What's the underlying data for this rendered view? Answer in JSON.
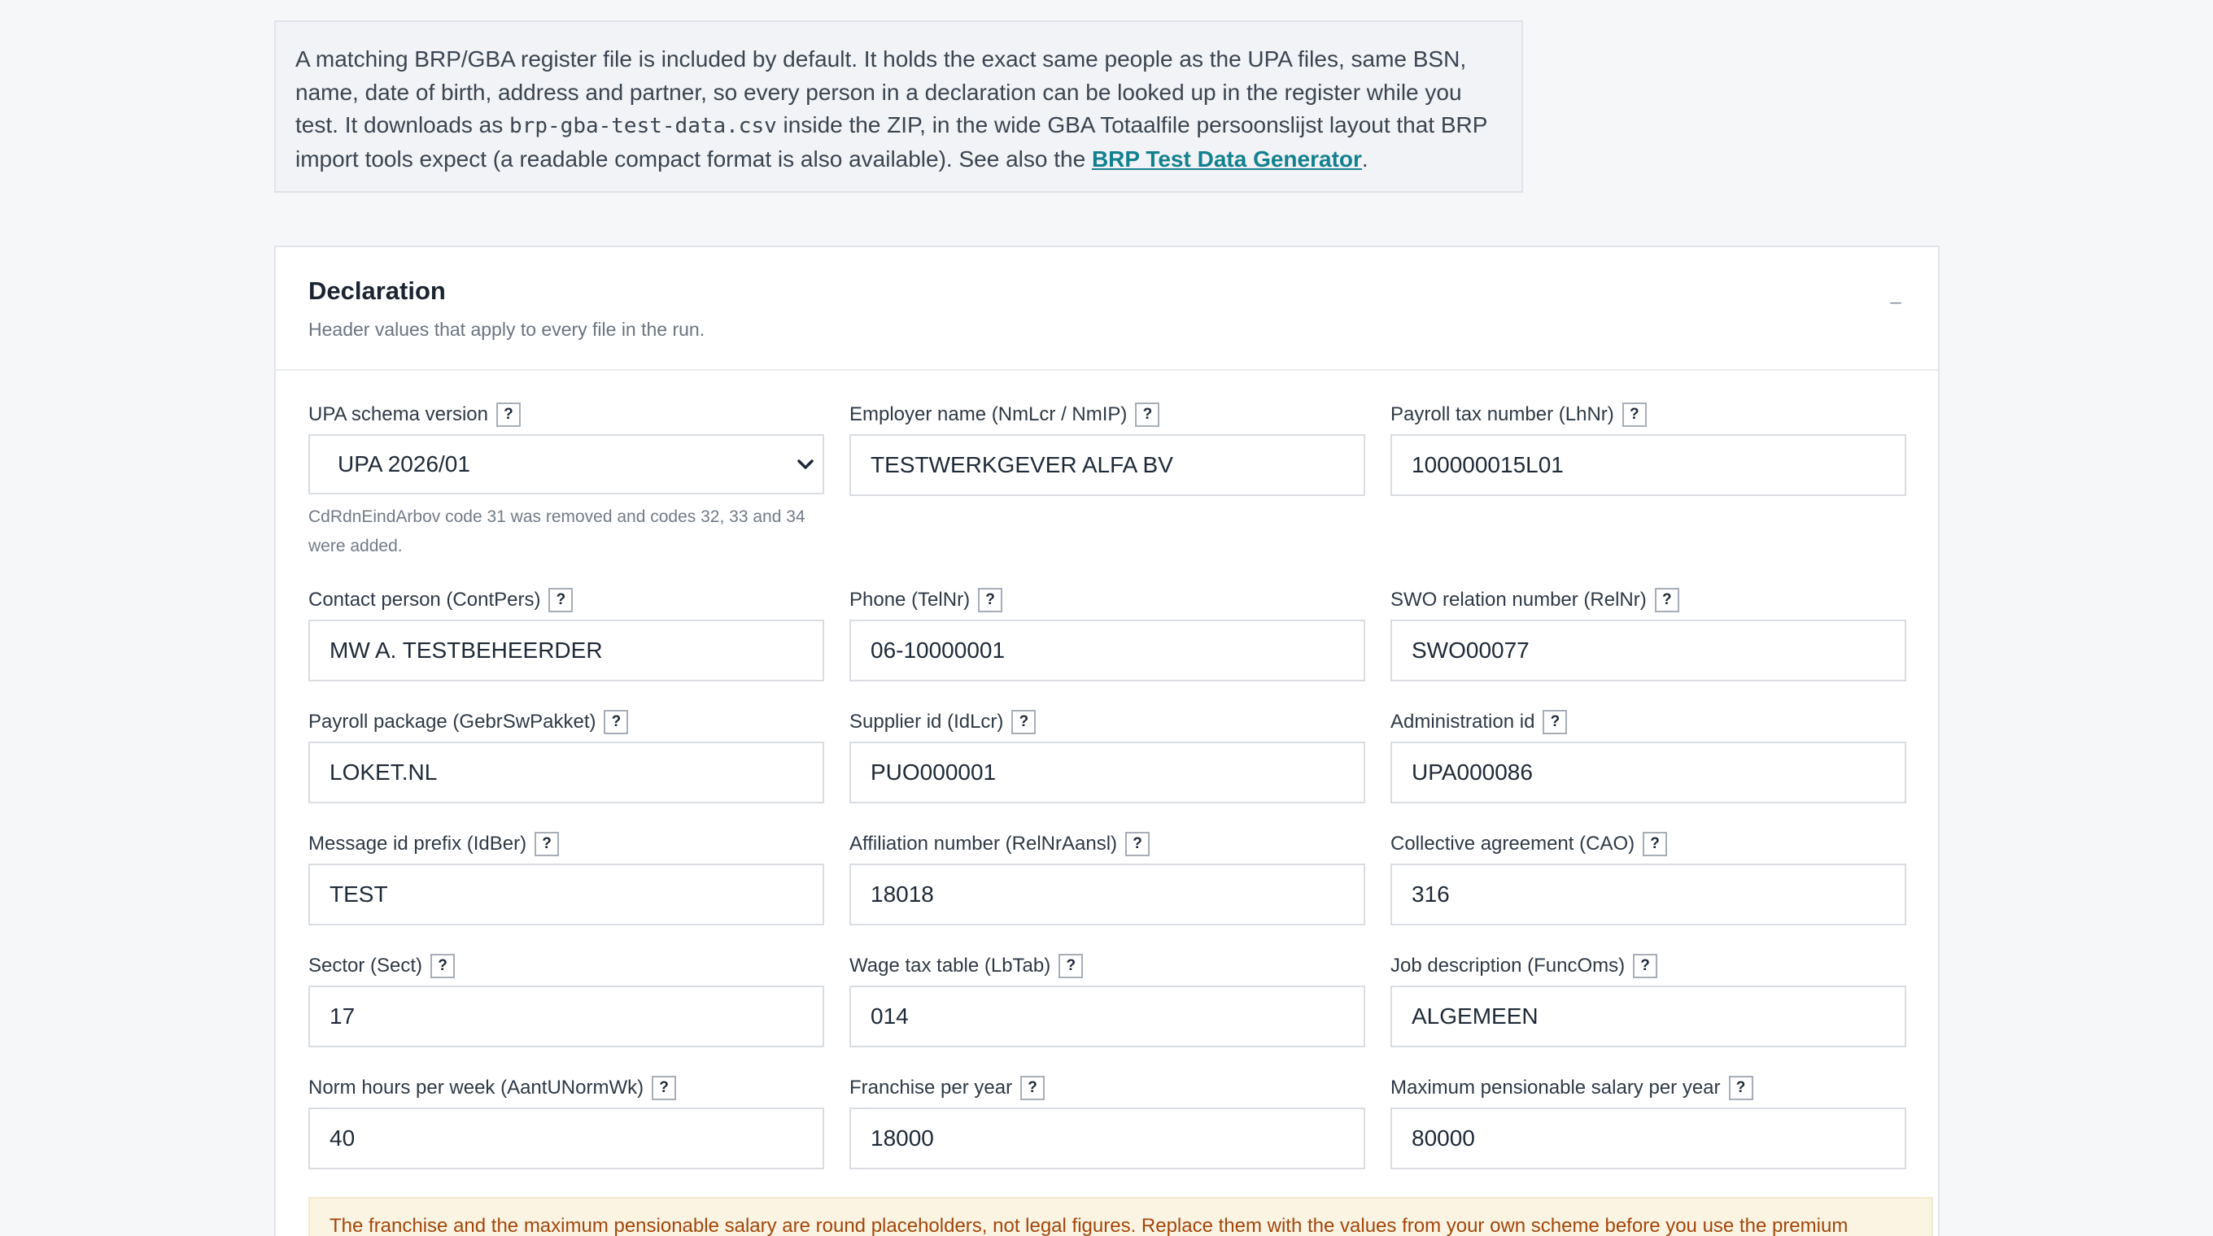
{
  "info": {
    "text_before": "A matching BRP/GBA register file is included by default. It holds the exact same people as the UPA files, same BSN, name, date of birth, address and partner, so every person in a declaration can be looked up in the register while you test. It downloads as ",
    "filename": "brp-gba-test-data.csv",
    "text_middle": " inside the ZIP, in the wide GBA Totaalfile persoonslijst layout that BRP import tools expect (a readable compact format is also available). See also the ",
    "link_text": "BRP Test Data Generator",
    "text_after": "."
  },
  "panel": {
    "title": "Declaration",
    "subtitle": "Header values that apply to every file in the run.",
    "collapse_symbol": "–"
  },
  "fields": {
    "schema_version": {
      "label": "UPA schema version",
      "value": "UPA 2026/01",
      "hint": "CdRdnEindArbov code 31 was removed and codes 32, 33 and 34 were added."
    },
    "employer_name": {
      "label": "Employer name (NmLcr / NmIP)",
      "value": "TESTWERKGEVER ALFA BV"
    },
    "payroll_tax_number": {
      "label": "Payroll tax number (LhNr)",
      "value": "100000015L01"
    },
    "contact_person": {
      "label": "Contact person (ContPers)",
      "value": "MW A. TESTBEHEERDER"
    },
    "phone": {
      "label": "Phone (TelNr)",
      "value": "06-10000001"
    },
    "swo_relation_number": {
      "label": "SWO relation number (RelNr)",
      "value": "SWO00077"
    },
    "payroll_package": {
      "label": "Payroll package (GebrSwPakket)",
      "value": "LOKET.NL"
    },
    "supplier_id": {
      "label": "Supplier id (IdLcr)",
      "value": "PUO000001"
    },
    "administration_id": {
      "label": "Administration id",
      "value": "UPA000086"
    },
    "message_id_prefix": {
      "label": "Message id prefix (IdBer)",
      "value": "TEST"
    },
    "affiliation_number": {
      "label": "Affiliation number (RelNrAansl)",
      "value": "18018"
    },
    "collective_agreement": {
      "label": "Collective agreement (CAO)",
      "value": "316"
    },
    "sector": {
      "label": "Sector (Sect)",
      "value": "17"
    },
    "wage_tax_table": {
      "label": "Wage tax table (LbTab)",
      "value": "014"
    },
    "job_description": {
      "label": "Job description (FuncOms)",
      "value": "ALGEMEEN"
    },
    "norm_hours": {
      "label": "Norm hours per week (AantUNormWk)",
      "value": "40"
    },
    "franchise": {
      "label": "Franchise per year",
      "value": "18000"
    },
    "max_pensionable_salary": {
      "label": "Maximum pensionable salary per year",
      "value": "80000"
    }
  },
  "help_symbol": "?",
  "warning": "The franchise and the maximum pensionable salary are round placeholders, not legal figures. Replace them with the values from your own scheme before you use the premium amounts.",
  "colors": {
    "accent": "#13808f",
    "warning_text": "#a2460b",
    "warning_bg": "#fcf4e2"
  }
}
